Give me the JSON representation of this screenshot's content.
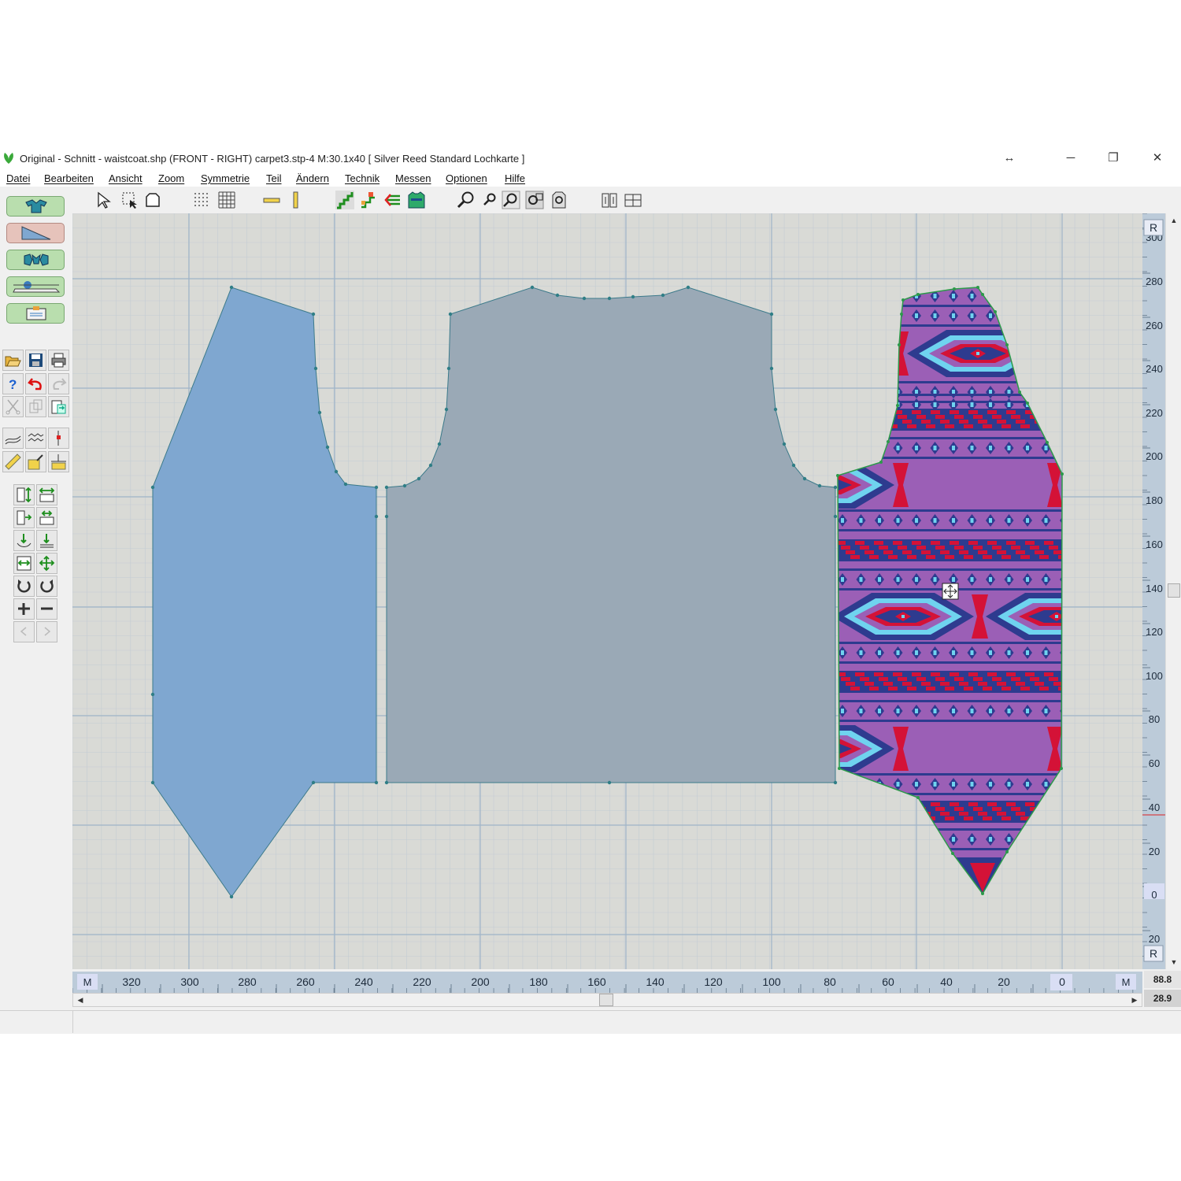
{
  "window": {
    "title": "Original - Schnitt - waistcoat.shp (FRONT - RIGHT)  carpet3.stp-4     M:30.1x40     [ Silver Reed Standard Lochkarte ]",
    "resize_glyph": "↔",
    "minimize_glyph": "─",
    "restore_glyph": "❐",
    "close_glyph": "✕"
  },
  "menu": [
    "Datei",
    "Bearbeiten",
    "Ansicht",
    "Zoom",
    "Symmetrie",
    "Teil",
    "Ändern",
    "Technik",
    "Messen",
    "Optionen",
    "Hilfe"
  ],
  "toolbar_icons": [
    "select-arrow-icon",
    "select-area-icon",
    "shape-outline-icon",
    "dot-grid-icon",
    "line-grid-icon",
    "horizontal-measure-icon",
    "vertical-measure-icon",
    "step-shaping-icon",
    "shaping-points-icon",
    "mirror-left-icon",
    "garment-pattern-icon",
    "zoom-in-icon",
    "zoom-out-icon",
    "zoom-fit-icon",
    "zoom-window-icon",
    "zoom-piece-icon",
    "piece-left-icon",
    "piece-right-icon"
  ],
  "mode_buttons": [
    "garment-mode-icon",
    "shaping-mode-icon",
    "pattern-mode-icon",
    "knitting-machine-mode-icon",
    "cards-mode-icon"
  ],
  "file_tools": [
    "open-icon",
    "save-icon",
    "print-icon",
    "help-icon",
    "undo-icon",
    "redo-icon",
    "cut-icon",
    "copy-icon",
    "paste-icon"
  ],
  "canvas": {
    "background": "#d9dad6",
    "gridline": "#9fb4c8",
    "minor_gridline": "#c3ccd3",
    "piece_left_color": "#7fa7d0",
    "piece_back_color": "#9aa9b6",
    "piece_outline": "#3c7a8a",
    "pattern_colors": {
      "base": "#9b5fb6",
      "dark": "#2e3b8f",
      "red": "#d41237",
      "light": "#6fd3ef"
    }
  },
  "ruler_x": {
    "labels": [
      "320",
      "300",
      "280",
      "260",
      "240",
      "220",
      "200",
      "180",
      "160",
      "140",
      "120",
      "100",
      "80",
      "60",
      "40",
      "20",
      "0"
    ],
    "marker_left": "M",
    "marker_right": "M"
  },
  "ruler_y": {
    "labels": [
      "300",
      "280",
      "260",
      "240",
      "220",
      "200",
      "180",
      "160",
      "140",
      "120",
      "100",
      "80",
      "60",
      "40",
      "20",
      "0",
      "20"
    ],
    "marker_top": "R",
    "marker_bottom": "R"
  },
  "readouts": {
    "x": "88.8",
    "y": "28.9"
  }
}
